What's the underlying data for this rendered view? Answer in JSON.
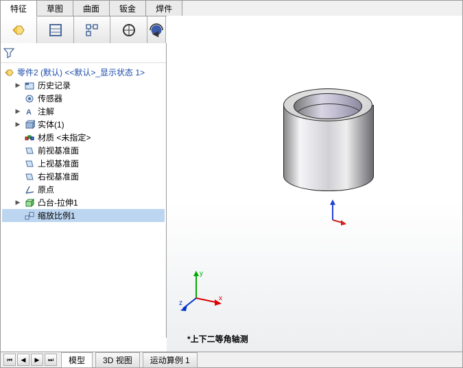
{
  "tabs": {
    "t0": "特征",
    "t1": "草图",
    "t2": "曲面",
    "t3": "钣金",
    "t4": "焊件"
  },
  "tree": {
    "root": "零件2 (默认) <<默认>_显示状态 1>",
    "items": [
      {
        "label": "历史记录",
        "exp": "▶"
      },
      {
        "label": "传感器",
        "exp": ""
      },
      {
        "label": "注解",
        "exp": "▶"
      },
      {
        "label": "实体(1)",
        "exp": "▶"
      },
      {
        "label": "材质 <未指定>",
        "exp": ""
      },
      {
        "label": "前视基准面",
        "exp": ""
      },
      {
        "label": "上视基准面",
        "exp": ""
      },
      {
        "label": "右视基准面",
        "exp": ""
      },
      {
        "label": "原点",
        "exp": ""
      },
      {
        "label": "凸台-拉伸1",
        "exp": "▶"
      },
      {
        "label": "缩放比例1",
        "exp": ""
      }
    ]
  },
  "view_label": "*上下二等角轴测",
  "bottom": {
    "b0": "模型",
    "b1": "3D 视图",
    "b2": "运动算例 1"
  },
  "triad": {
    "x": "x",
    "y": "y",
    "z": "z"
  }
}
